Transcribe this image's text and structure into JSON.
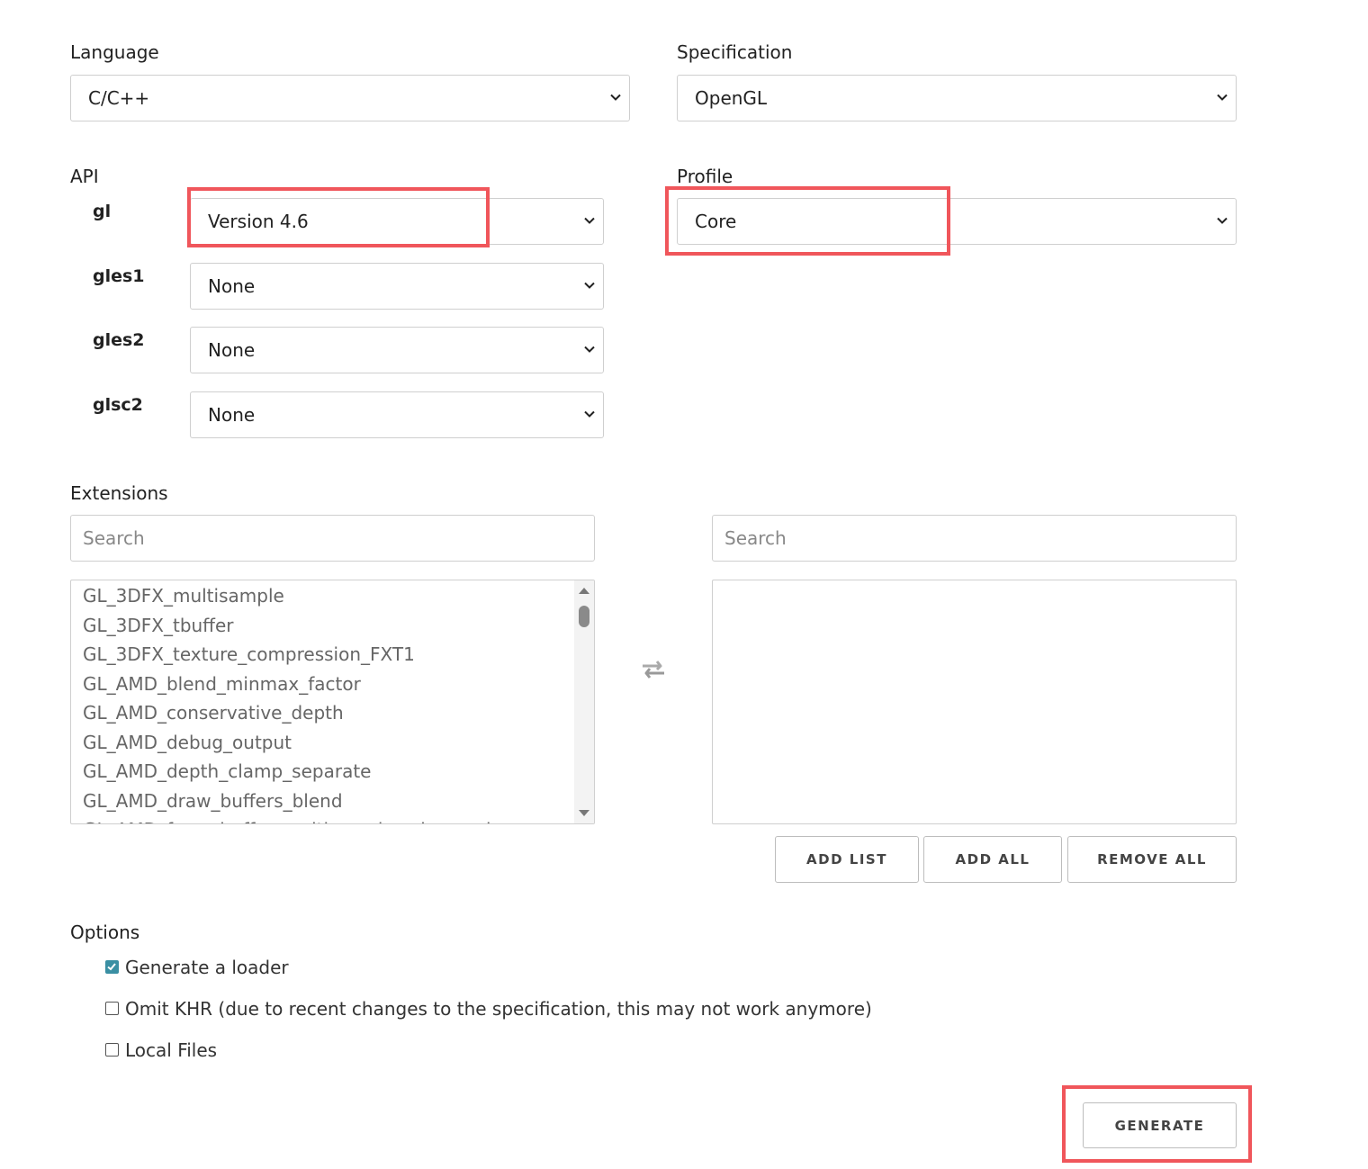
{
  "language": {
    "label": "Language",
    "value": "C/C++"
  },
  "specification": {
    "label": "Specification",
    "value": "OpenGL"
  },
  "api": {
    "label": "API",
    "rows": [
      {
        "name": "gl",
        "value": "Version 4.6"
      },
      {
        "name": "gles1",
        "value": "None"
      },
      {
        "name": "gles2",
        "value": "None"
      },
      {
        "name": "glsc2",
        "value": "None"
      }
    ]
  },
  "profile": {
    "label": "Profile",
    "value": "Core"
  },
  "extensions": {
    "label": "Extensions",
    "left_search_placeholder": "Search",
    "right_search_placeholder": "Search",
    "available": [
      "GL_3DFX_multisample",
      "GL_3DFX_tbuffer",
      "GL_3DFX_texture_compression_FXT1",
      "GL_AMD_blend_minmax_factor",
      "GL_AMD_conservative_depth",
      "GL_AMD_debug_output",
      "GL_AMD_depth_clamp_separate",
      "GL_AMD_draw_buffers_blend",
      "GL_AMD_framebuffer_multisample_advanced"
    ],
    "buttons": {
      "add_list": "ADD LIST",
      "add_all": "ADD ALL",
      "remove_all": "REMOVE ALL"
    }
  },
  "options": {
    "label": "Options",
    "items": [
      {
        "label": "Generate a loader",
        "checked": true
      },
      {
        "label": "Omit KHR (due to recent changes to the specification, this may not work anymore)",
        "checked": false
      },
      {
        "label": "Local Files",
        "checked": false
      }
    ]
  },
  "generate_label": "GENERATE",
  "colors": {
    "highlight": "#f0565b",
    "checkbox_accent": "#3a8fa3"
  }
}
